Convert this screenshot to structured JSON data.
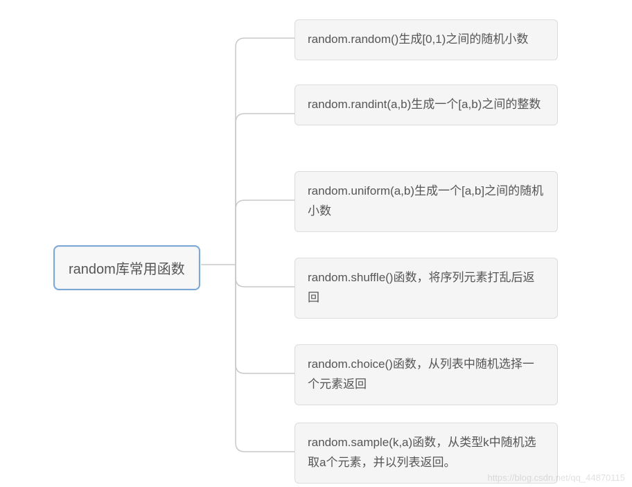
{
  "root": {
    "label": "random库常用函数"
  },
  "children": [
    {
      "text": "random.random()生成[0,1)之间的随机小数"
    },
    {
      "text": "random.randint(a,b)生成一个[a,b)之间的整数"
    },
    {
      "text": "random.uniform(a,b)生成一个[a,b]之间的随机小数"
    },
    {
      "text": "random.shuffle()函数，将序列元素打乱后返回"
    },
    {
      "text": "random.choice()函数，从列表中随机选择一个元素返回"
    },
    {
      "text": "random.sample(k,a)函数，从类型k中随机选取a个元素，并以列表返回。"
    }
  ],
  "watermark": "https://blog.csdn.net/qq_44870115"
}
